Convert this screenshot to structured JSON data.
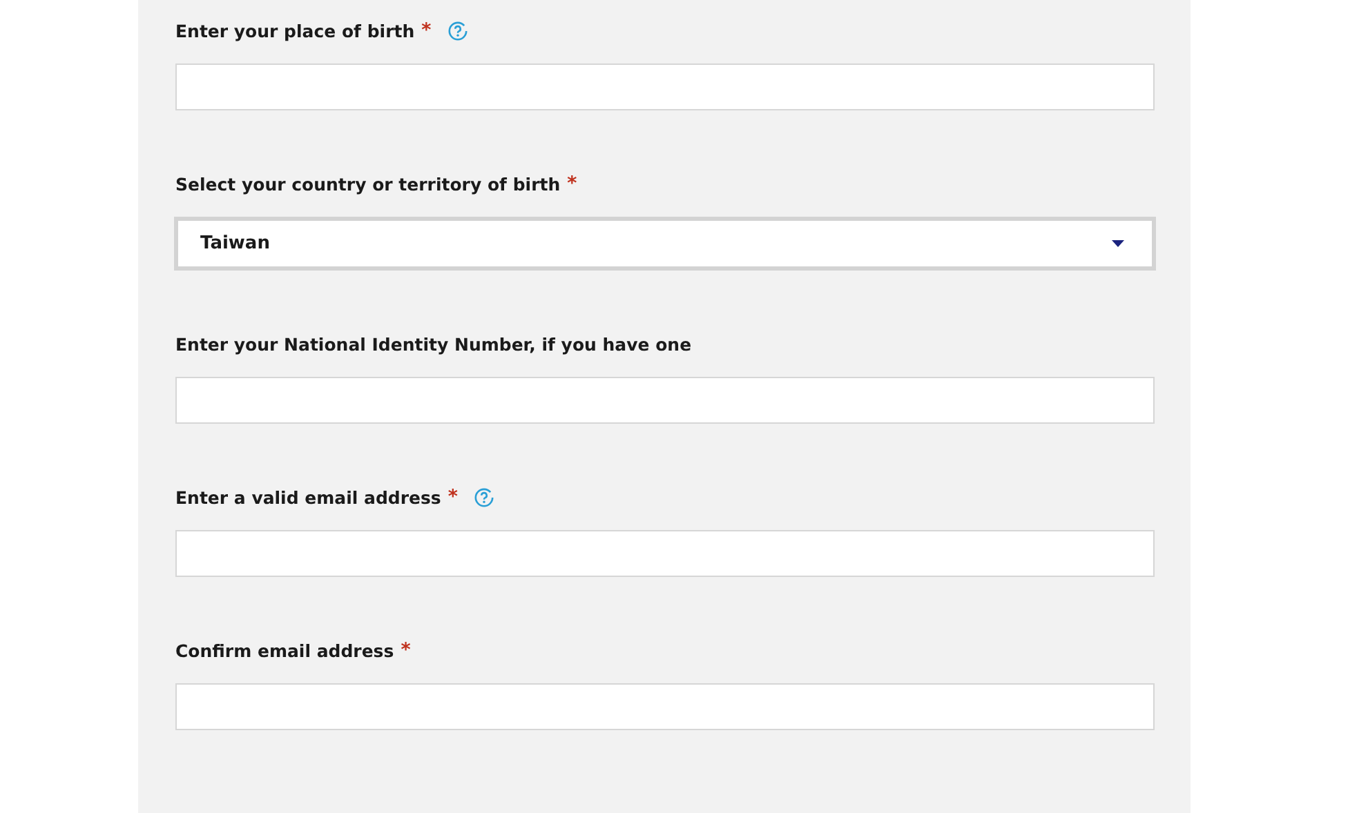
{
  "fields": [
    {
      "kind": "text",
      "label": "Enter your place of birth",
      "required_mark": "*",
      "help": true
    },
    {
      "kind": "select",
      "label": "Select your country or territory of birth",
      "required_mark": "*",
      "help": false,
      "value": "Taiwan"
    },
    {
      "kind": "text",
      "label": "Enter your National Identity Number, if you have one",
      "help": false
    },
    {
      "kind": "text",
      "label": "Enter a valid email address",
      "required_mark": "*",
      "help": true
    },
    {
      "kind": "text",
      "label": "Confirm email address",
      "required_mark": "*",
      "help": false
    }
  ]
}
